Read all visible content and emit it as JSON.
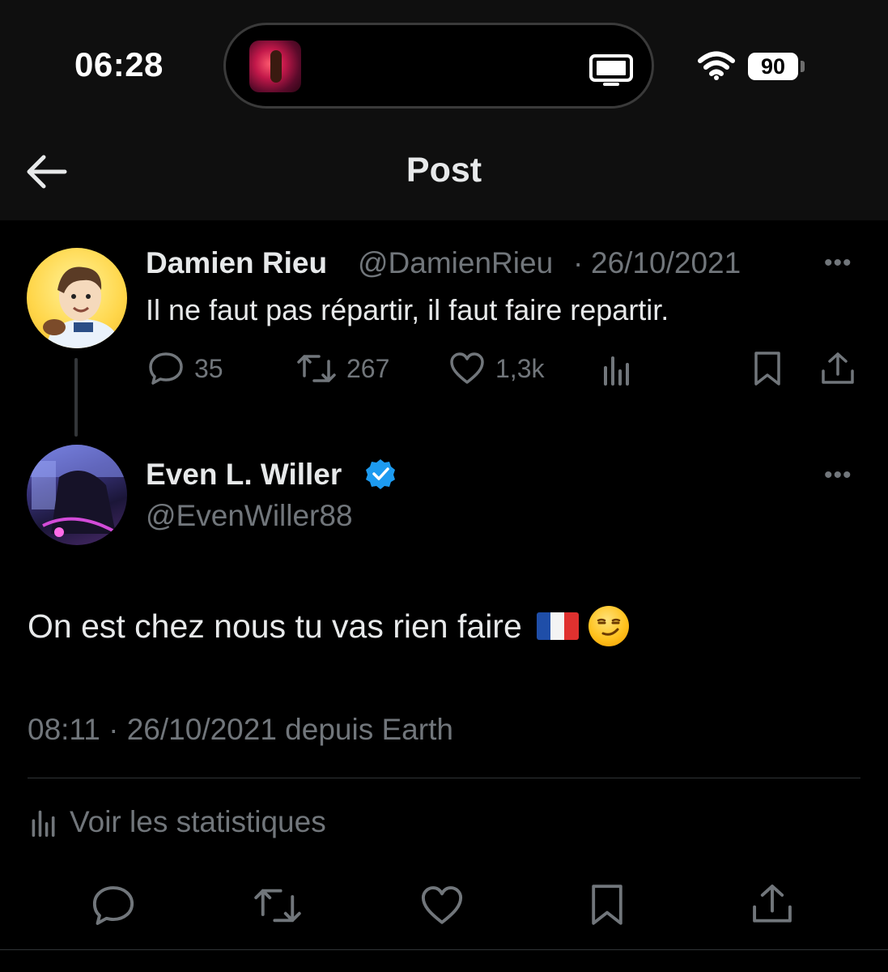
{
  "status_bar": {
    "time": "06:28",
    "island_icon": "tv-icon",
    "battery": "90"
  },
  "header": {
    "title": "Post",
    "back_icon": "arrow-left-icon"
  },
  "parent_post": {
    "name": "Damien Rieu",
    "handle": "@DamienRieu",
    "separator": "·",
    "date": "26/10/2021",
    "text": "Il ne faut pas répartir, il faut faire repartir.",
    "replies": "35",
    "reposts": "267",
    "likes": "1,3k"
  },
  "main_post": {
    "name": "Even L. Willer",
    "verified": true,
    "handle": "@EvenWiller88",
    "text": "On est chez nous tu vas rien faire",
    "emojis": [
      "flag-france",
      "smirking-face"
    ],
    "timestamp": "08:11 · 26/10/2021 depuis Earth",
    "stats_label": "Voir les statistiques"
  },
  "action_bar": [
    "reply-icon",
    "repost-icon",
    "like-icon",
    "bookmark-icon",
    "share-icon"
  ],
  "colors": {
    "background": "#000000",
    "header_bg": "#0f0f0f",
    "text": "#e7e9ea",
    "muted": "#71767b",
    "verified": "#1d9bf0",
    "divider": "#2f3336"
  }
}
